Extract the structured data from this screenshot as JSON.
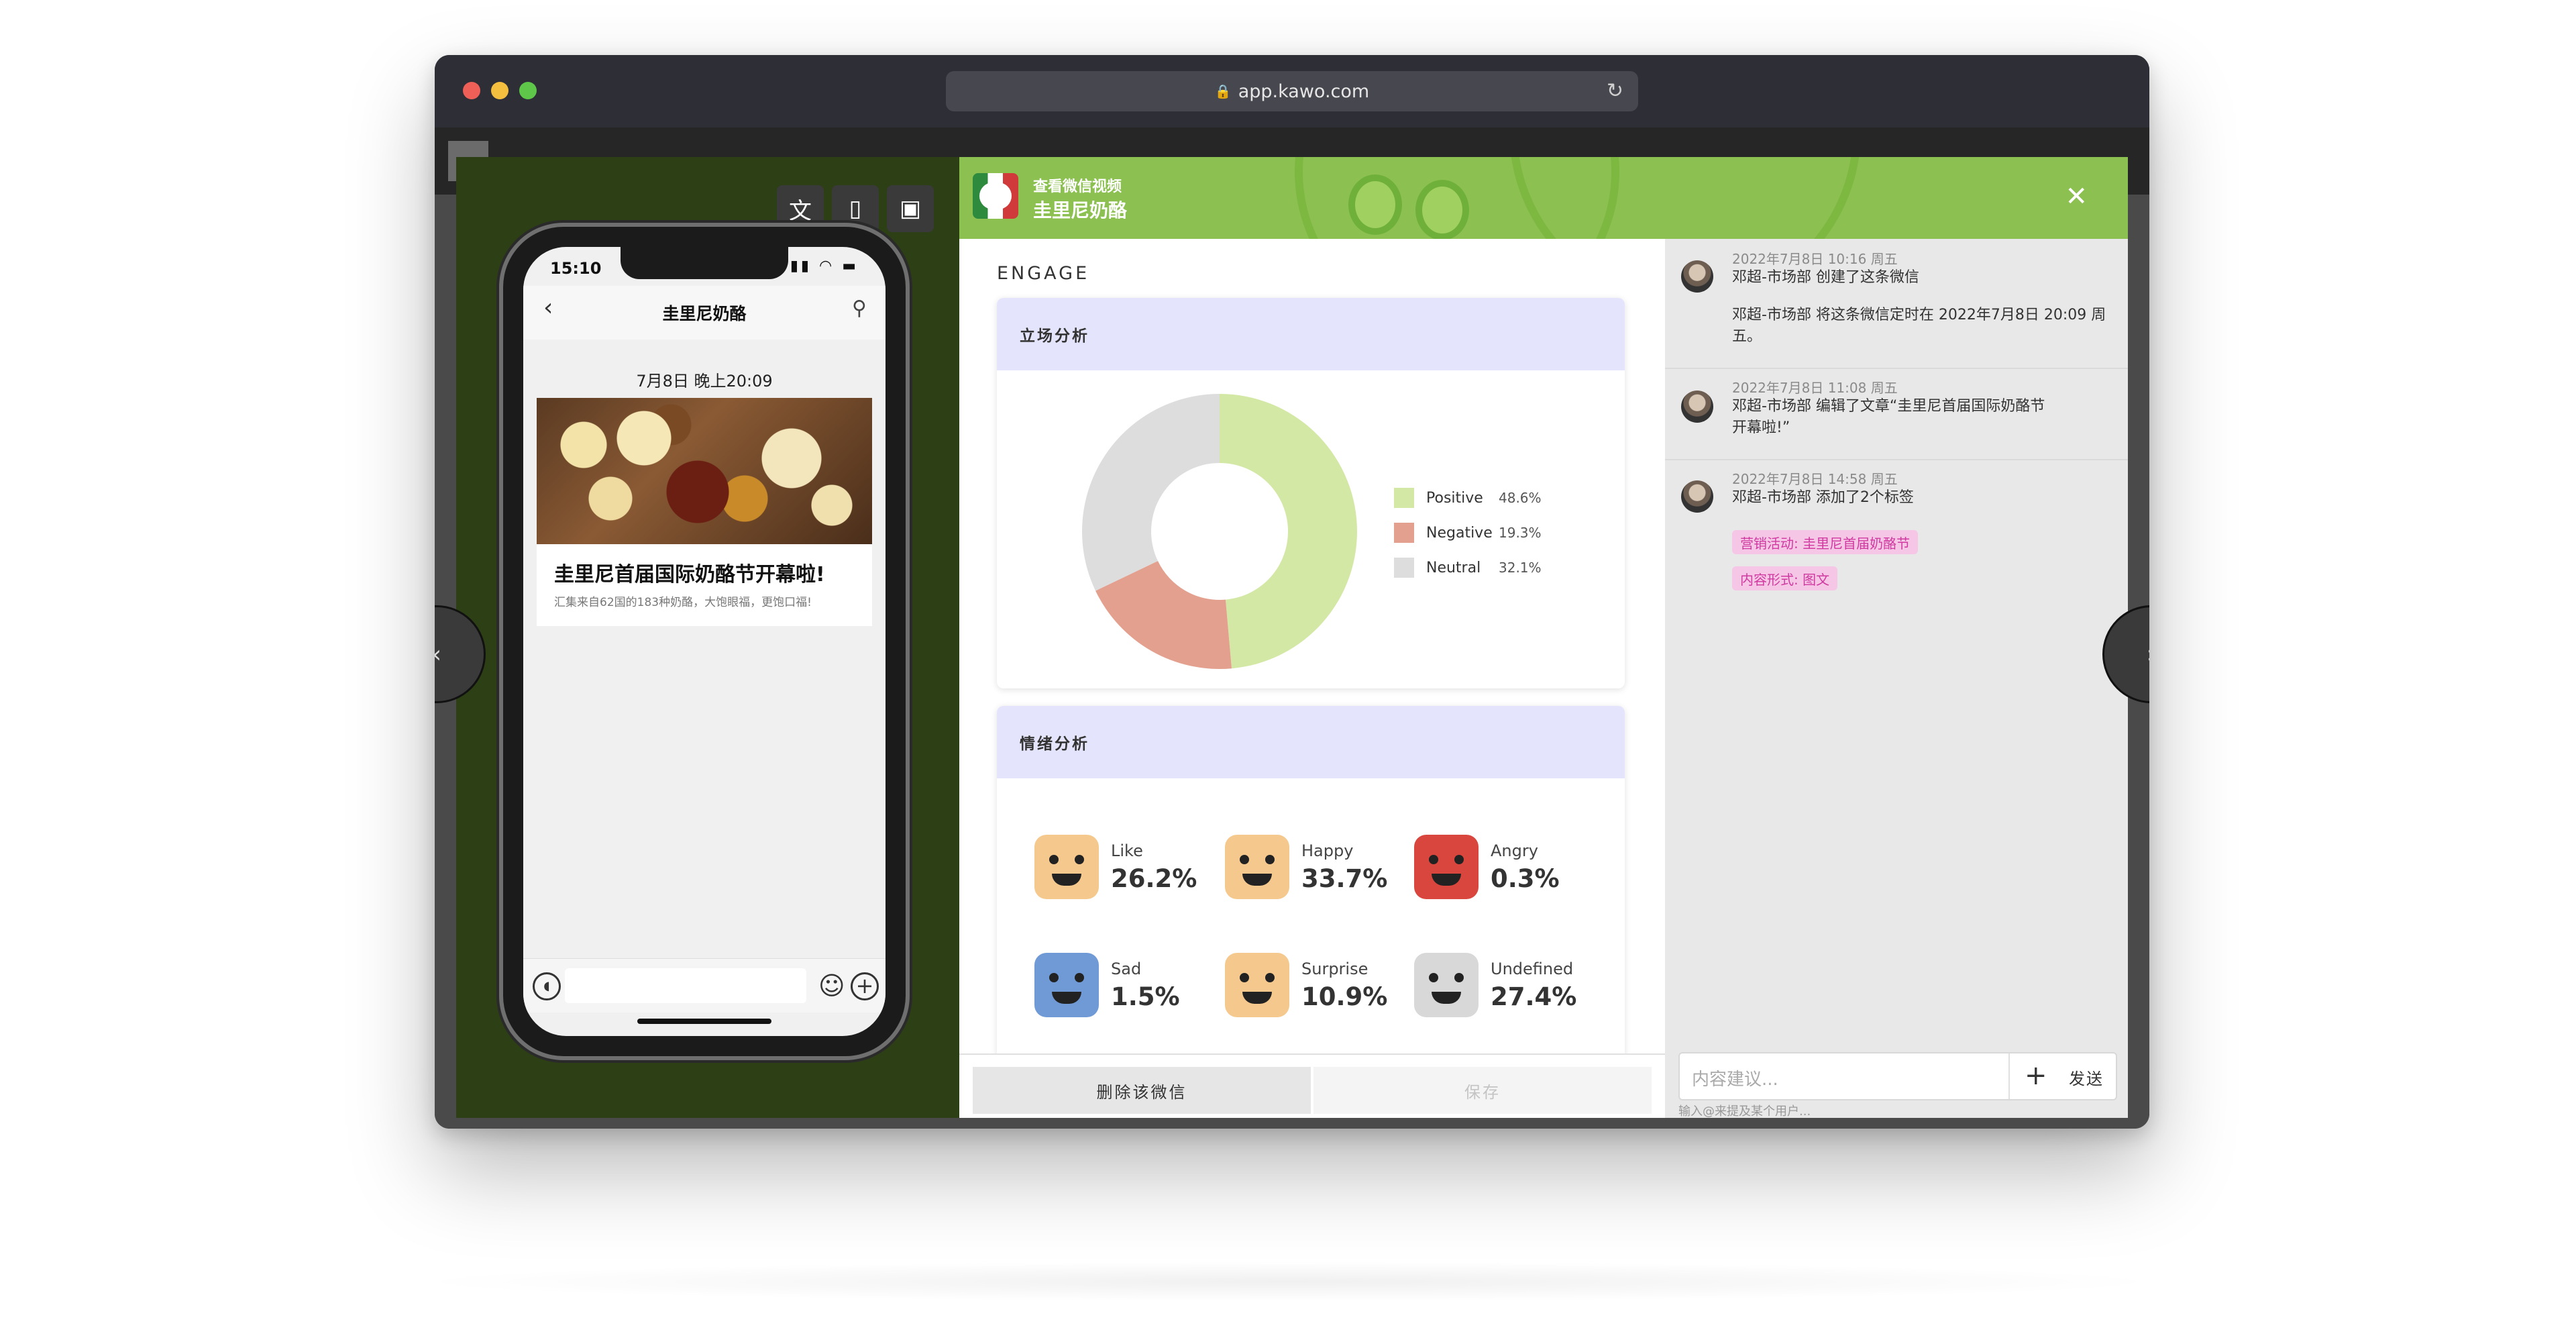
{
  "browser": {
    "url": "app.kawo.com"
  },
  "modal": {
    "header_sub": "查看微信视频",
    "header_title": "圭里尼奶酪"
  },
  "phone": {
    "time": "15:10",
    "account": "圭里尼奶酪",
    "date": "7月8日 晚上20:09",
    "article_title": "圭里尼首届国际奶酪节开幕啦!",
    "article_desc": "汇集来自62国的183种奶酪，大饱眼福，更饱口福!"
  },
  "section_title": "ENGAGE",
  "stance": {
    "title": "立场分析",
    "chart_data": {
      "type": "pie",
      "categories": [
        "Positive",
        "Negative",
        "Neutral"
      ],
      "values": [
        48.6,
        19.3,
        32.1
      ],
      "labels": [
        "48.6%",
        "19.3%",
        "32.1%"
      ],
      "colors": [
        "#d4e8a6",
        "#e3a08e",
        "#dddddd"
      ],
      "legend": "right"
    }
  },
  "emotion": {
    "title": "情绪分析",
    "items": [
      {
        "label": "Like",
        "value": "26.2%",
        "color": "#f5c98d",
        "icon": "heart-eyes-face-icon"
      },
      {
        "label": "Happy",
        "value": "33.7%",
        "color": "#f5c98d",
        "icon": "grinning-face-icon"
      },
      {
        "label": "Angry",
        "value": "0.3%",
        "color": "#d9463e",
        "icon": "angry-face-icon"
      },
      {
        "label": "Sad",
        "value": "1.5%",
        "color": "#6f9ad6",
        "icon": "crying-face-icon"
      },
      {
        "label": "Surprise",
        "value": "10.9%",
        "color": "#f5c98d",
        "icon": "surprised-face-icon"
      },
      {
        "label": "Undefined",
        "value": "27.4%",
        "color": "#d8d8d8",
        "icon": "neutral-face-icon"
      }
    ]
  },
  "actions": {
    "delete": "删除该微信",
    "save": "保存"
  },
  "activity": [
    {
      "time": "2022年7月8日 10:16 周五",
      "lines": [
        "邓超-市场部  创建了这条微信",
        "邓超-市场部  将这条微信定时在 2022年7月8日 20:09 周五。"
      ]
    },
    {
      "time": "2022年7月8日 11:08 周五",
      "lines": [
        "邓超-市场部  编辑了文章“圭里尼首届国际奶酪节开幕啦!”"
      ]
    },
    {
      "time": "2022年7月8日 14:58 周五",
      "lines": [
        "邓超-市场部  添加了2个标签"
      ],
      "tags": [
        "营销活动: 圭里尼首届奶酪节",
        "内容形式: 图文"
      ]
    }
  ],
  "comment": {
    "placeholder": "内容建议...",
    "send": "发送",
    "hint": "输入@来提及某个用户..."
  }
}
